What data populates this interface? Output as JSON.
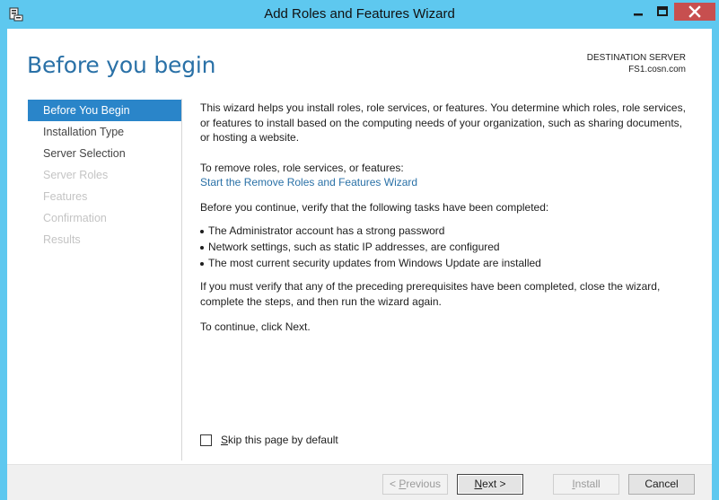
{
  "window": {
    "title": "Add Roles and Features Wizard",
    "icons": {
      "app": "server-manager-icon",
      "minimize": "minimize-icon",
      "maximize": "maximize-icon",
      "close": "close-icon"
    },
    "accent_color": "#5ec8ef"
  },
  "page": {
    "heading": "Before you begin",
    "destination_label": "DESTINATION SERVER",
    "destination_server": "FS1.cosn.com"
  },
  "nav": {
    "items": [
      {
        "label": "Before You Begin",
        "state": "active"
      },
      {
        "label": "Installation Type",
        "state": "enabled"
      },
      {
        "label": "Server Selection",
        "state": "enabled"
      },
      {
        "label": "Server Roles",
        "state": "disabled"
      },
      {
        "label": "Features",
        "state": "disabled"
      },
      {
        "label": "Confirmation",
        "state": "disabled"
      },
      {
        "label": "Results",
        "state": "disabled"
      }
    ],
    "active_color": "#2a85c9"
  },
  "content": {
    "intro": "This wizard helps you install roles, role services, or features. You determine which roles, role services, or features to install based on the computing needs of your organization, such as sharing documents, or hosting a website.",
    "remove_label": "To remove roles, role services, or features:",
    "remove_link": "Start the Remove Roles and Features Wizard",
    "verify_label": "Before you continue, verify that the following tasks have been completed:",
    "requirements": [
      "The Administrator account has a strong password",
      "Network settings, such as static IP addresses, are configured",
      "The most current security updates from Windows Update are installed"
    ],
    "prereq_note": "If you must verify that any of the preceding prerequisites have been completed, close the wizard, complete the steps, and then run the wizard again.",
    "continue_note": "To continue, click Next."
  },
  "skip": {
    "label": "Skip this page by default",
    "checked": false
  },
  "buttons": {
    "previous": "< Previous",
    "next": "Next >",
    "install": "Install",
    "cancel": "Cancel"
  }
}
